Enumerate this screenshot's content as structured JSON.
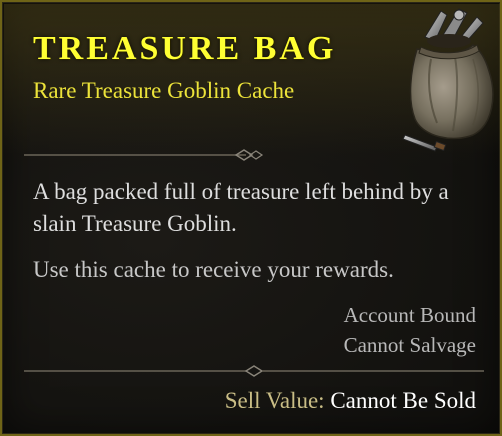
{
  "item": {
    "name": "TREASURE BAG",
    "type": "Rare Treasure Goblin Cache",
    "description": "A bag packed full of treasure left behind by a slain Treasure Goblin.",
    "usage": "Use this cache to receive your rewards.",
    "flags": [
      "Account Bound",
      "Cannot Salvage"
    ],
    "sell_label": "Sell Value:",
    "sell_value": "Cannot Be Sold",
    "icon": "treasure-bag-icon"
  },
  "colors": {
    "rarity_rare": "#ffff33",
    "border": "#6f6417",
    "sell_label": "#c9bd86"
  }
}
